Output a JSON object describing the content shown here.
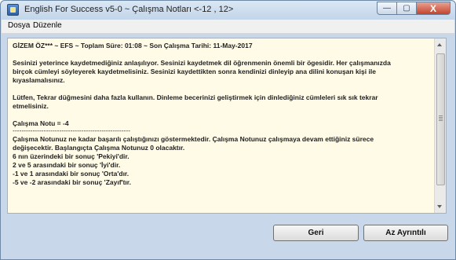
{
  "window": {
    "title": "English For Success v5-0  ~  Çalışma Notları <-12 , 12>",
    "minimize_label": "—",
    "maximize_label": "▢",
    "close_label": "X"
  },
  "menu": {
    "items": [
      "Dosya",
      "Düzenle"
    ]
  },
  "content": {
    "header": "GİZEM ÖZ*** ~ EFS ~ Toplam Süre: 01:08 ~ Son Çalışma Tarihi: 11-May-2017",
    "para1": [
      "Sesinizi yeterince kaydetmediğiniz anlaşılıyor.  Sesinizi kaydetmek dil öğrenmenin önemli bir ögesidir. Her çalışmanızda",
      "birçok cümleyi söyleyerek kaydetmelisiniz. Sesinizi kaydettikten sonra kendinizi dinleyip ana dilini konuşan kişi ile",
      "kıyaslamalısınız."
    ],
    "para2": [
      "Lütfen, Tekrar düğmesini daha fazla kullanın.  Dinleme becerinizi geliştirmek için dinlediğiniz cümleleri sık sık tekrar",
      "etmelisiniz."
    ],
    "score_line": "Çalışma Notu = -4",
    "separator": "-----------------------------------------------------",
    "para3": [
      "Çalışma Notunuz ne kadar başarılı çalıştığınızı göstermektedir.  Çalışma Notunuz çalışmaya devam ettiğiniz sürece",
      "değişecektir.  Başlangıçta Çalışma Notunuz  0  olacaktır."
    ],
    "ranges": [
      " 6 nın üzerindeki bir sonuç 'Pekiyi'dir.",
      " 2 ve 5 arasındaki bir sonuç 'İyi'dir.",
      " -1 ve 1 arasındaki bir sonuç 'Orta'dır.",
      " -5 ve -2 arasındaki bir sonuç 'Zayıf'tır."
    ]
  },
  "buttons": {
    "back": "Geri",
    "details": "Az Ayrıntılı"
  }
}
